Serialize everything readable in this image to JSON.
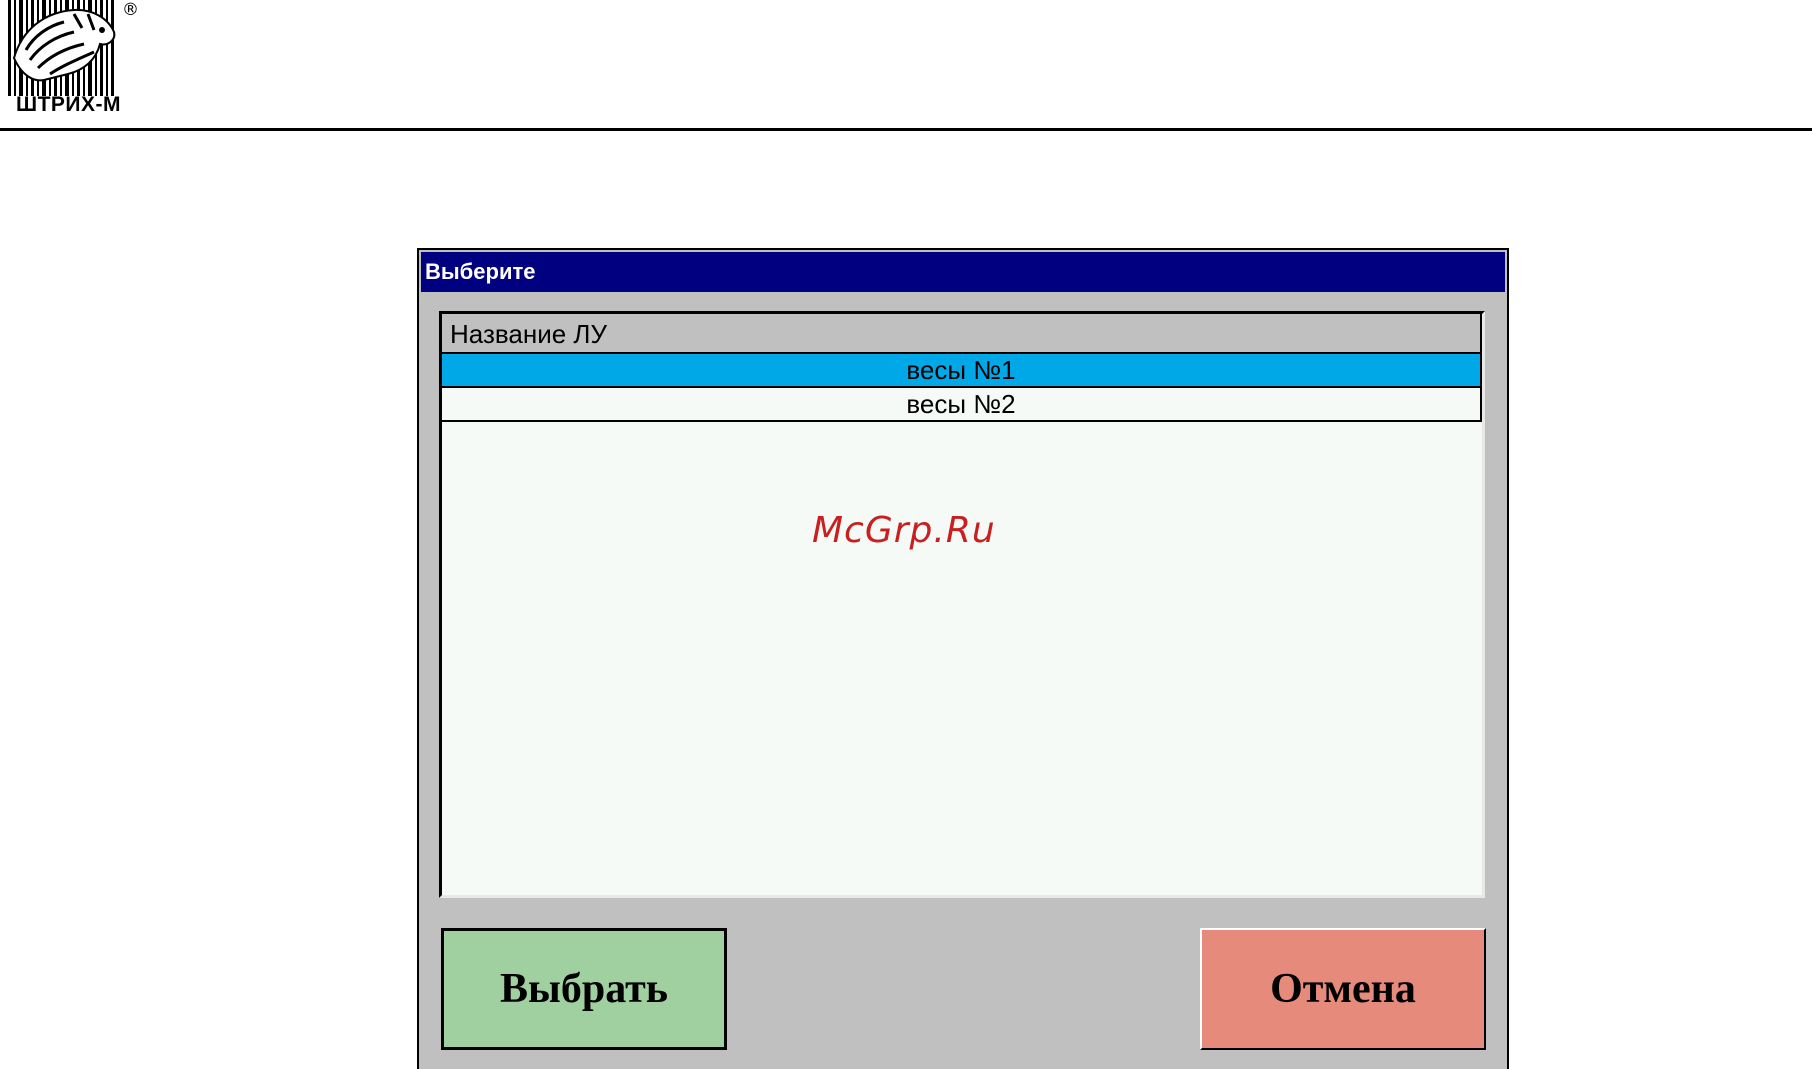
{
  "logo": {
    "brand": "ШТРИХ-М",
    "registered_mark": "®"
  },
  "dialog": {
    "title": "Выберите",
    "list": {
      "column_header": "Название ЛУ",
      "rows": [
        {
          "label": "весы №1",
          "selected": true
        },
        {
          "label": "весы №2",
          "selected": false
        }
      ]
    },
    "buttons": {
      "select_label": "Выбрать",
      "cancel_label": "Отмена"
    }
  },
  "watermark": "McGrp.Ru",
  "colors": {
    "titlebar": "#000080",
    "selected_row": "#00a8e8",
    "select_button": "#a0d0a0",
    "cancel_button": "#e68a7c",
    "dialog_bg": "#c0c0c0"
  }
}
